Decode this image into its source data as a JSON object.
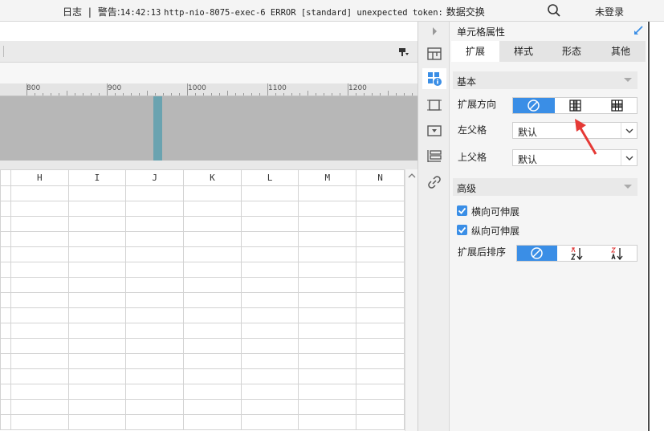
{
  "topbar": {
    "log_label": "日志",
    "separator": "|",
    "warn_prefix": "警告:",
    "time": "14:42:13",
    "message": "http-nio-8075-exec-6 ERROR [standard] unexpected token:",
    "message_tail": "数据交换",
    "login": "未登录"
  },
  "ruler": {
    "labels": [
      "800",
      "900",
      "1000",
      "1100",
      "1200"
    ]
  },
  "grid": {
    "columns": [
      "H",
      "I",
      "J",
      "K",
      "L",
      "M",
      "N"
    ]
  },
  "panel": {
    "title": "单元格属性",
    "tabs": [
      {
        "label": "扩展"
      },
      {
        "label": "样式"
      },
      {
        "label": "形态"
      },
      {
        "label": "其他"
      }
    ],
    "basic": {
      "title": "基本",
      "expand_direction_label": "扩展方向",
      "left_parent_label": "左父格",
      "left_parent_value": "默认",
      "top_parent_label": "上父格",
      "top_parent_value": "默认"
    },
    "advanced": {
      "title": "高级",
      "horizontal_label": "横向可伸展",
      "horizontal_checked": true,
      "vertical_label": "纵向可伸展",
      "vertical_checked": true,
      "sort_label": "扩展后排序"
    }
  },
  "colors": {
    "accent": "#3a8ee6",
    "bar": "#6aa3b0",
    "arrow": "#e53935"
  }
}
